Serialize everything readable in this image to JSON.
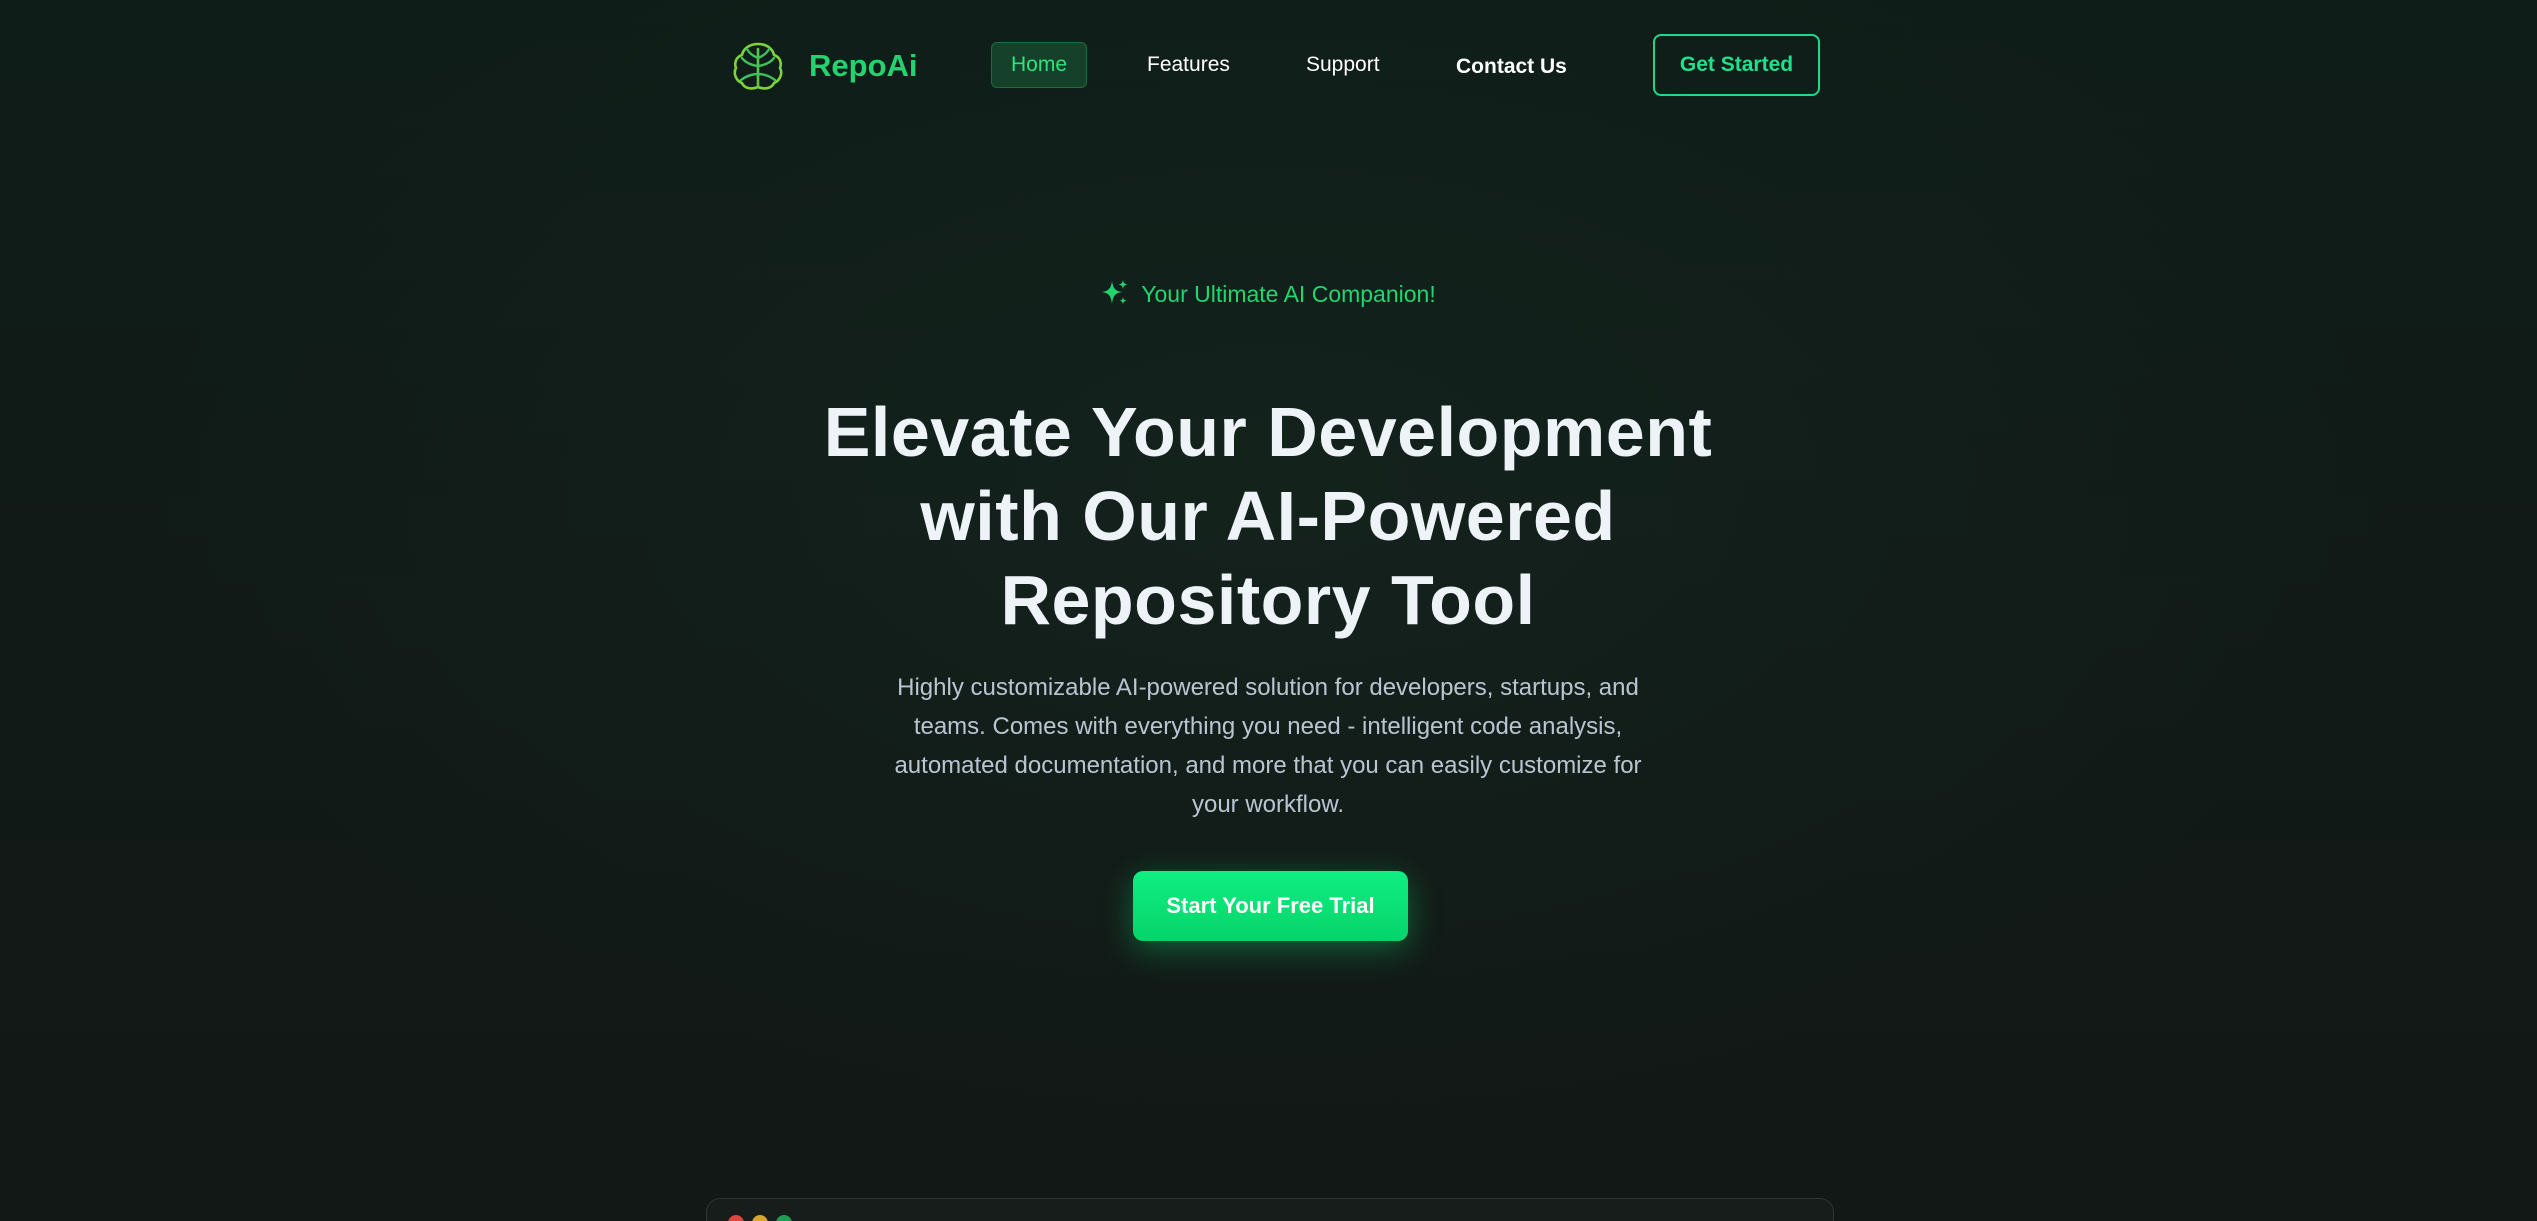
{
  "nav": {
    "brand": "RepoAi",
    "logo_icon": "brain-leaf-icon",
    "links": [
      "Home",
      "Features",
      "Support",
      "Contact Us"
    ],
    "active_link": "Home",
    "cta_label": "Get Started"
  },
  "hero": {
    "tagline_icon": "sparkle-icon",
    "tagline": "Your Ultimate AI Companion!",
    "headline": "Elevate Your Development with Our AI-Powered Repository Tool",
    "subtext": "Highly customizable AI-powered solution for developers, startups, and teams. Comes with everything you need - intelligent code analysis, automated documentation, and more that you can easily customize for your workflow.",
    "cta_label": "Start Your Free Trial"
  },
  "colors": {
    "accent": "#22d36f",
    "background": "#101a16",
    "headline": "#eef3f8",
    "body_text": "#b9c6d2"
  }
}
